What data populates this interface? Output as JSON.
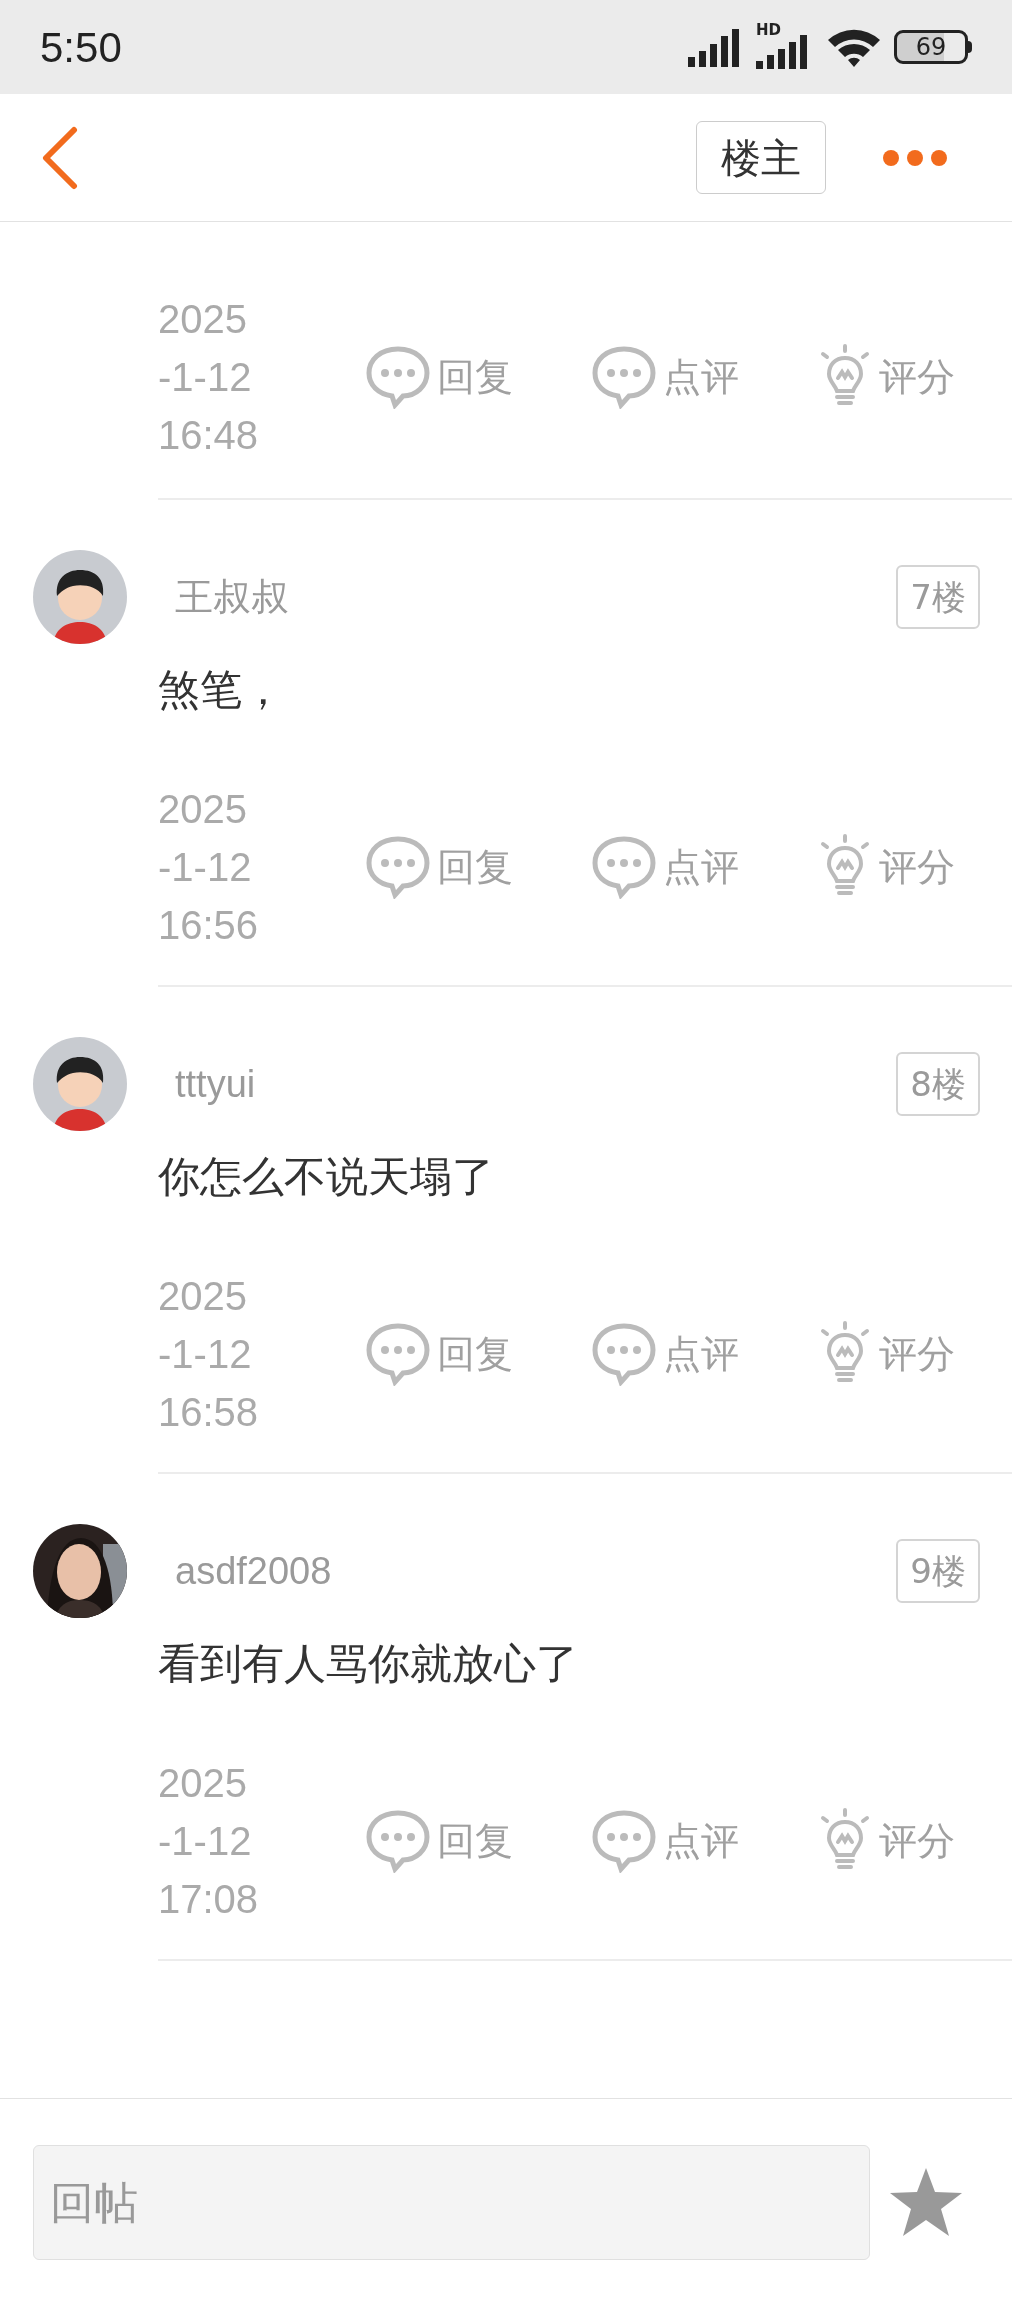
{
  "status_bar": {
    "time": "5:50",
    "network_label": "HD",
    "battery": "69"
  },
  "header": {
    "author_button": "楼主"
  },
  "posts": [
    {
      "time": "2025\n-1-12\n16:48",
      "actions": [
        {
          "kind": "reply",
          "label": "回复"
        },
        {
          "kind": "comment",
          "label": "点评"
        },
        {
          "kind": "rate",
          "label": "评分"
        }
      ]
    },
    {
      "avatar": {
        "kind": "cartoon"
      },
      "user": "王叔叔",
      "floor": "7楼",
      "content": "煞笔，",
      "time": "2025\n-1-12\n16:56",
      "actions": [
        {
          "kind": "reply",
          "label": "回复"
        },
        {
          "kind": "comment",
          "label": "点评"
        },
        {
          "kind": "rate",
          "label": "评分"
        }
      ]
    },
    {
      "avatar": {
        "kind": "cartoon"
      },
      "user": "tttyui",
      "floor": "8楼",
      "content": "你怎么不说天塌了",
      "time": "2025\n-1-12\n16:58",
      "actions": [
        {
          "kind": "reply",
          "label": "回复"
        },
        {
          "kind": "comment",
          "label": "点评"
        },
        {
          "kind": "rate",
          "label": "评分"
        }
      ]
    },
    {
      "avatar": {
        "kind": "photo"
      },
      "user": "asdf2008",
      "floor": "9楼",
      "content": "看到有人骂你就放心了",
      "time": "2025\n-1-12\n17:08",
      "actions": [
        {
          "kind": "reply",
          "label": "回复"
        },
        {
          "kind": "comment",
          "label": "点评"
        },
        {
          "kind": "rate",
          "label": "评分"
        }
      ]
    }
  ],
  "reply_bar": {
    "placeholder": "回帖"
  }
}
